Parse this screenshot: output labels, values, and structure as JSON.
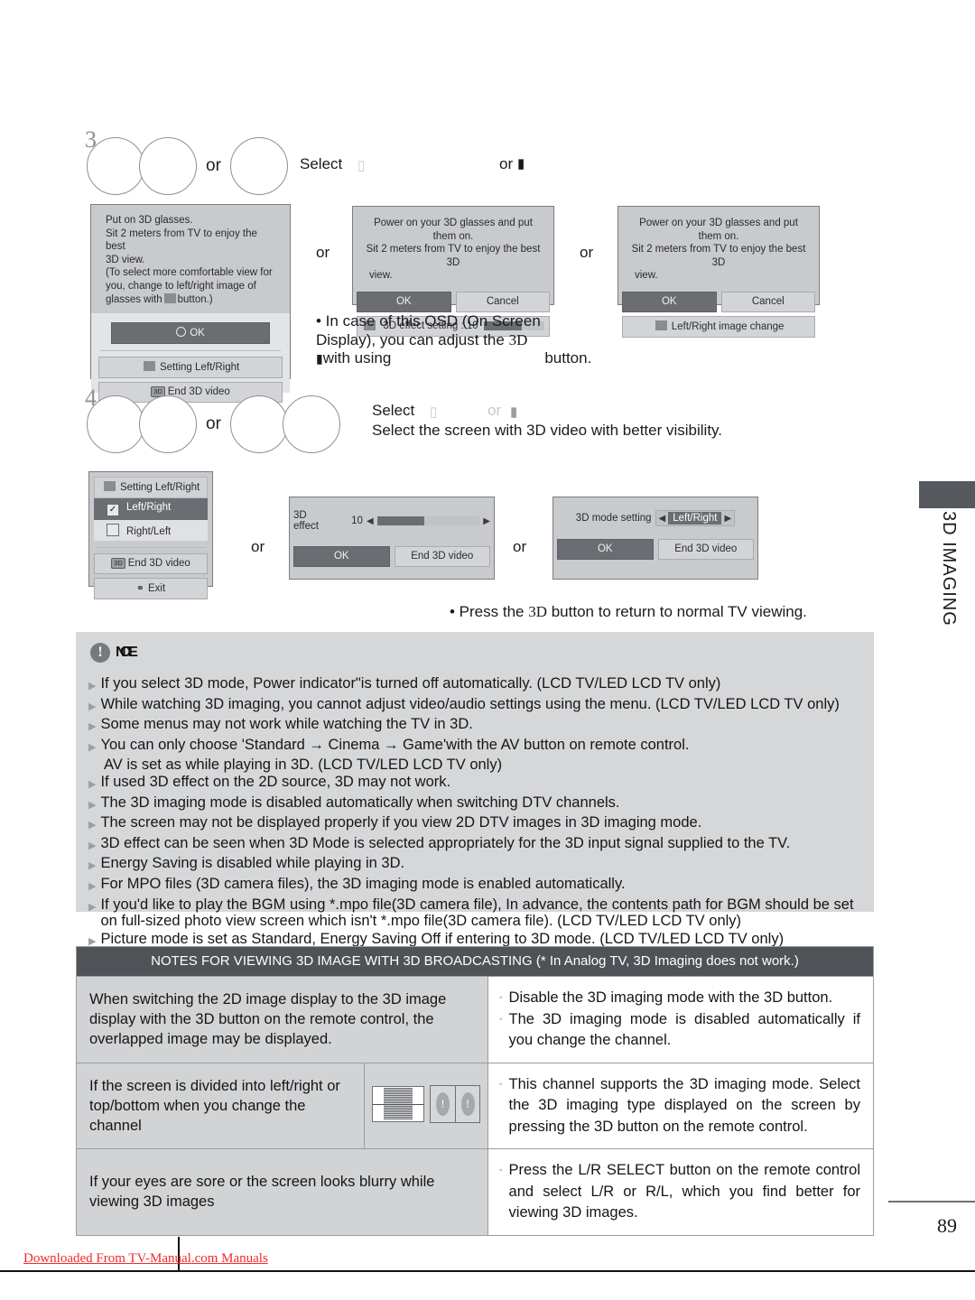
{
  "page": {
    "number": "89",
    "side_label": "3D IMAGING",
    "watermark": "Downloaded From TV-Manual.com Manuals"
  },
  "step3": {
    "number": "3",
    "or_word": "or",
    "select_label": "Select",
    "or_label": "or",
    "dialog_a": {
      "message": "Put on 3D glasses.\nSit 2 meters from TV to enjoy the best 3D view.\n(To select more comfortable view for you, change to left/right image of glasses with ■ button.)",
      "line1": "Put on 3D glasses.",
      "line2": "Sit 2 meters from TV to enjoy the best",
      "line3": "3D view.",
      "line4": "(To select more comfortable view for",
      "line5": "you, change to left/right image of",
      "line6_pre": "glasses with",
      "line6_post": "button.)",
      "ok": "OK",
      "setting_lr": "Setting Left/Right",
      "end_3d": "End 3D video",
      "icon_3d": "3D"
    },
    "dialog_b": {
      "line1": "Power on your 3D glasses and put them on.",
      "line2": "Sit 2 meters from TV to enjoy the best 3D",
      "line3": "view.",
      "ok": "OK",
      "cancel": "Cancel",
      "effect_label": "3D effect setting : 10"
    },
    "dialog_c": {
      "line1": "Power on your 3D glasses and put them on.",
      "line2": "Sit 2 meters from TV to enjoy the best 3D",
      "line3": "view.",
      "ok": "OK",
      "cancel": "Cancel",
      "lr_change": "Left/Right image change"
    },
    "note_line1": "• In case of this OSD (On Screen",
    "note_line2_a": "Display), you can adjust the ",
    "note_line2_b": "3D",
    "note_line3_a": "with using",
    "note_line3_b": "button."
  },
  "step4": {
    "number": "4",
    "or_word": "or",
    "select_label": "Select",
    "or_label": "or",
    "desc": "Select the screen with 3D video with better visibility.",
    "menu": {
      "header": "Setting Left/Right",
      "item_lr": "Left/Right",
      "item_rl": "Right/Left",
      "end_3d": "End 3D video",
      "exit": "Exit",
      "icon_3d": "3D"
    },
    "effect_dialog": {
      "label": "3D effect",
      "value": "10",
      "ok": "OK",
      "end_3d": "End 3D video"
    },
    "mode_dialog": {
      "label": "3D mode setting",
      "value": "Left/Right",
      "ok": "OK",
      "end_3d": "End 3D video"
    },
    "or_word_2": "or",
    "return_note_a": "• Press the ",
    "return_note_b": "3D",
    "return_note_c": " button to return to normal TV viewing."
  },
  "notes": {
    "icon": "exclamation-circle-icon",
    "title": "NOTE",
    "items": [
      "If you select 3D mode, Power indicator\"is turned off automatically.    (LCD TV/LED LCD TV only)",
      "While watching 3D imaging, you cannot adjust video/audio settings using the menu. (LCD TV/LED LCD TV only)",
      "Some menus may not work while watching the TV in 3D.",
      "You can only choose 'Standard  → Cinema → Game'with the AV button on remote control.",
      "If used 3D effect on the 2D source, 3D may not work.",
      "The 3D imaging mode is disabled automatically when switching DTV channels.",
      "The screen may not be displayed properly if you view 2D DTV images in 3D imaging mode.",
      "3D effect can be seen when 3D Mode is selected appropriately for the 3D input signal supplied to the TV.",
      "Energy Saving is disabled while playing in 3D.",
      "For MPO files (3D camera files), the 3D imaging mode is enabled automatically.",
      "If you'd like to play the BGM using *.mpo file(3D camera file), In advance, the contents path for BGM should be set on full-sized photo view screen which isn't *.mpo file(3D camera file). (LCD TV/LED LCD TV only)",
      "Picture mode is set as Standard, Energy Saving Off if entering to 3D mode. (LCD TV/LED LCD TV only)"
    ],
    "item4_sub": "AV is set as  while playing in                     3D. (LCD TV/LED LCD TV only)"
  },
  "table": {
    "header": "NOTES FOR VIEWING 3D IMAGE WITH 3D BROADCASTING (* In Analog TV, 3D Imaging does not work.)",
    "rows": [
      {
        "left": "When switching the 2D image display to the 3D image display with the 3D button on the remote control, the overlapped image may be displayed.",
        "has_icon": false,
        "right": [
          "Disable the 3D imaging mode with the 3D button.",
          "The 3D imaging mode is disabled automatically if you change the channel."
        ]
      },
      {
        "left": "If the screen is divided into left/right or top/bottom when you change the channel",
        "has_icon": true,
        "icon": "split-screen-icon",
        "right": [
          "This channel supports the 3D imaging mode. Select the 3D imaging type displayed on the screen by pressing the 3D button on the remote control."
        ]
      },
      {
        "left": "If your eyes are sore or the screen looks blurry while viewing 3D images",
        "has_icon": false,
        "right": [
          "Press the L/R SELECT button on the remote control and select L/R or R/L, which you find better for viewing 3D images."
        ]
      }
    ]
  },
  "colors": {
    "osd_bg": "#c8cacd",
    "osd_border": "#7b7d81",
    "btn_dark": "#6b6d73",
    "note_bg": "#d6d7d9",
    "table_head": "#4f5257",
    "watermark": "#f3292b"
  }
}
